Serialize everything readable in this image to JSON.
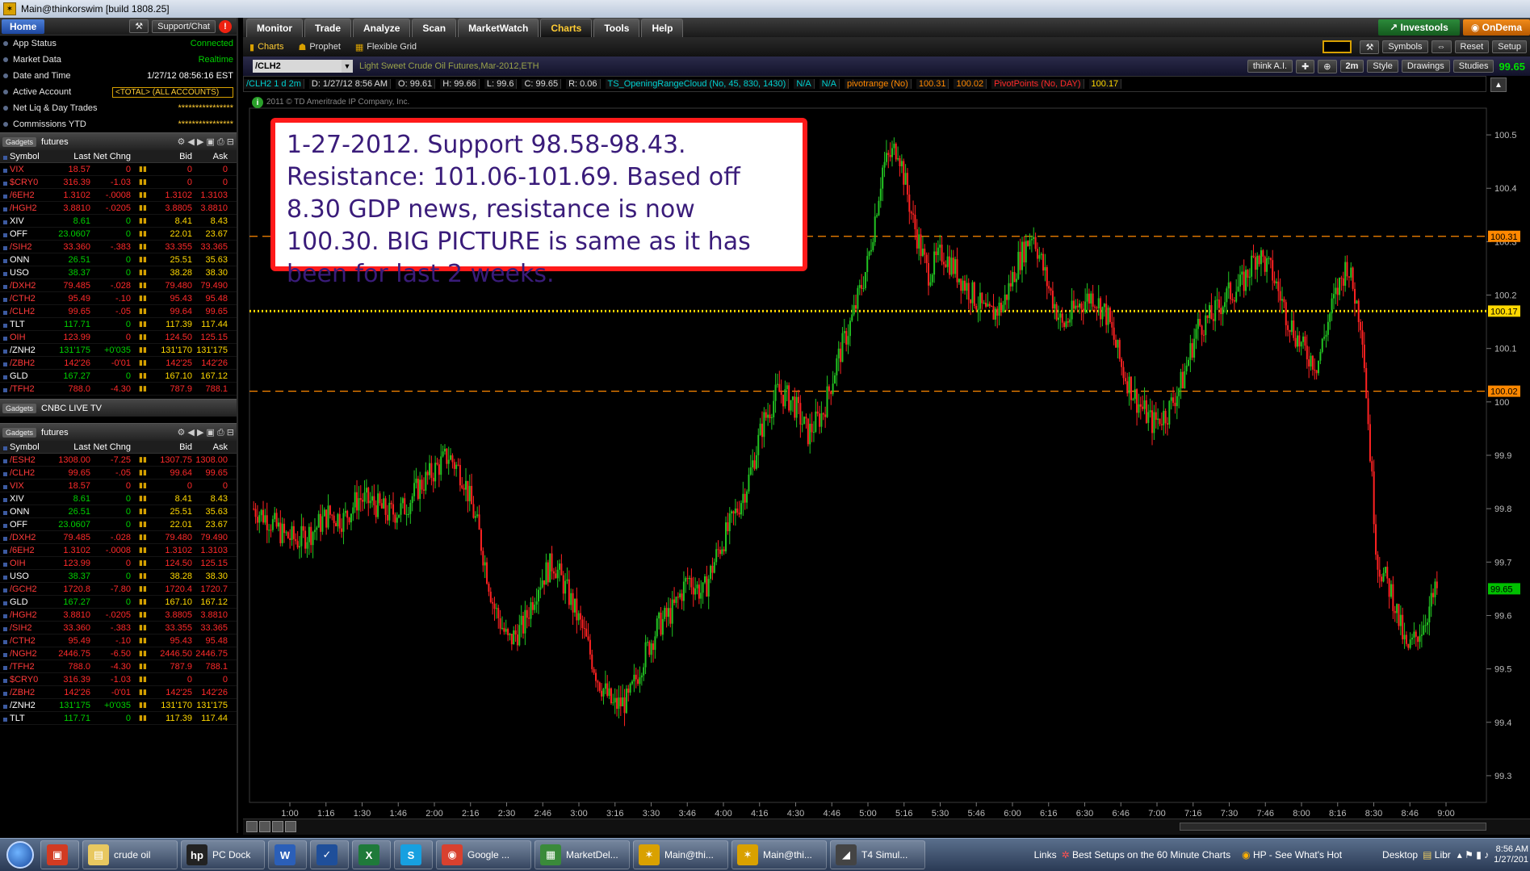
{
  "window": {
    "title": "Main@thinkorswim [build 1808.25]"
  },
  "left": {
    "home_label": "Home",
    "support_label": "Support/Chat",
    "status": [
      {
        "label": "App Status",
        "value": "Connected"
      },
      {
        "label": "Market Data",
        "value": "Realtime"
      },
      {
        "label": "Date and Time",
        "value": "1/27/12 08:56:16 EST"
      },
      {
        "label": "Active Account",
        "value": "<TOTAL> (ALL ACCOUNTS)"
      },
      {
        "label": "Net Liq & Day Trades",
        "value": "****************"
      },
      {
        "label": "Commissions YTD",
        "value": "****************"
      }
    ],
    "gadgets_label": "Gadgets",
    "wl1_name": "futures",
    "cnbc_label": "CNBC LIVE TV",
    "wl2_name": "futures",
    "columns": {
      "symbol": "Symbol",
      "last": "Last",
      "chg": "Net Chng",
      "bid": "Bid",
      "ask": "Ask"
    },
    "watchlist1": [
      [
        "VIX",
        "18.57",
        "0",
        "0",
        "0",
        "dn"
      ],
      [
        "$CRY0",
        "316.39",
        "-1.03",
        "0",
        "0",
        "dn"
      ],
      [
        "/6EH2",
        "1.3102",
        "-.0008",
        "1.3102",
        "1.3103",
        "dn"
      ],
      [
        "/HGH2",
        "3.8810",
        "-.0205",
        "3.8805",
        "3.8810",
        "dn"
      ],
      [
        "XIV",
        "8.61",
        "0",
        "8.41",
        "8.43",
        "up"
      ],
      [
        "OFF",
        "23.0607",
        "0",
        "22.01",
        "23.67",
        "up"
      ],
      [
        "/SIH2",
        "33.360",
        "-.383",
        "33.355",
        "33.365",
        "dn"
      ],
      [
        "ONN",
        "26.51",
        "0",
        "25.51",
        "35.63",
        "up"
      ],
      [
        "USO",
        "38.37",
        "0",
        "38.28",
        "38.30",
        "up"
      ],
      [
        "/DXH2",
        "79.485",
        "-.028",
        "79.480",
        "79.490",
        "dn"
      ],
      [
        "/CTH2",
        "95.49",
        "-.10",
        "95.43",
        "95.48",
        "dn"
      ],
      [
        "/CLH2",
        "99.65",
        "-.05",
        "99.64",
        "99.65",
        "dn"
      ],
      [
        "TLT",
        "117.71",
        "0",
        "117.39",
        "117.44",
        "up"
      ],
      [
        "OIH",
        "123.99",
        "0",
        "124.50",
        "125.15",
        "dn"
      ],
      [
        "/ZNH2",
        "131'175",
        "+0'035",
        "131'170",
        "131'175",
        "up"
      ],
      [
        "/ZBH2",
        "142'26",
        "-0'01",
        "142'25",
        "142'26",
        "dn"
      ],
      [
        "GLD",
        "167.27",
        "0",
        "167.10",
        "167.12",
        "up"
      ],
      [
        "/TFH2",
        "788.0",
        "-4.30",
        "787.9",
        "788.1",
        "dn"
      ]
    ],
    "watchlist2": [
      [
        "/ESH2",
        "1308.00",
        "-7.25",
        "1307.75",
        "1308.00",
        "dn"
      ],
      [
        "/CLH2",
        "99.65",
        "-.05",
        "99.64",
        "99.65",
        "dn"
      ],
      [
        "VIX",
        "18.57",
        "0",
        "0",
        "0",
        "dn"
      ],
      [
        "XIV",
        "8.61",
        "0",
        "8.41",
        "8.43",
        "up"
      ],
      [
        "ONN",
        "26.51",
        "0",
        "25.51",
        "35.63",
        "up"
      ],
      [
        "OFF",
        "23.0607",
        "0",
        "22.01",
        "23.67",
        "up"
      ],
      [
        "/DXH2",
        "79.485",
        "-.028",
        "79.480",
        "79.490",
        "dn"
      ],
      [
        "/6EH2",
        "1.3102",
        "-.0008",
        "1.3102",
        "1.3103",
        "dn"
      ],
      [
        "OIH",
        "123.99",
        "0",
        "124.50",
        "125.15",
        "dn"
      ],
      [
        "USO",
        "38.37",
        "0",
        "38.28",
        "38.30",
        "up"
      ],
      [
        "/GCH2",
        "1720.8",
        "-7.80",
        "1720.4",
        "1720.7",
        "dn"
      ],
      [
        "GLD",
        "167.27",
        "0",
        "167.10",
        "167.12",
        "up"
      ],
      [
        "/HGH2",
        "3.8810",
        "-.0205",
        "3.8805",
        "3.8810",
        "dn"
      ],
      [
        "/SIH2",
        "33.360",
        "-.383",
        "33.355",
        "33.365",
        "dn"
      ],
      [
        "/CTH2",
        "95.49",
        "-.10",
        "95.43",
        "95.48",
        "dn"
      ],
      [
        "/NGH2",
        "2446.75",
        "-6.50",
        "2446.50",
        "2446.75",
        "dn"
      ],
      [
        "/TFH2",
        "788.0",
        "-4.30",
        "787.9",
        "788.1",
        "dn"
      ],
      [
        "$CRY0",
        "316.39",
        "-1.03",
        "0",
        "0",
        "dn"
      ],
      [
        "/ZBH2",
        "142'26",
        "-0'01",
        "142'25",
        "142'26",
        "dn"
      ],
      [
        "/ZNH2",
        "131'175",
        "+0'035",
        "131'170",
        "131'175",
        "up"
      ],
      [
        "TLT",
        "117.71",
        "0",
        "117.39",
        "117.44",
        "up"
      ]
    ]
  },
  "tabs": [
    "Monitor",
    "Trade",
    "Analyze",
    "Scan",
    "MarketWatch",
    "Charts",
    "Tools",
    "Help"
  ],
  "active_tab": "Charts",
  "investools_label": "Investools",
  "ondemand_label": "OnDema",
  "subtabs": [
    "Charts",
    "Prophet",
    "Flexible Grid"
  ],
  "toolbar": {
    "symbols": "Symbols",
    "reset": "Reset",
    "setup": "Setup",
    "think": "think A.I.",
    "period": "2m",
    "style": "Style",
    "drawings": "Drawings",
    "studies": "Studies",
    "last_price": "99.65"
  },
  "chart_header": {
    "symbol": "/CLH2",
    "description": "Light Sweet Crude Oil Futures,Mar-2012,ETH",
    "study_items": [
      {
        "t": "/CLH2 1 d 2m",
        "c": "#00d0d0"
      },
      {
        "t": "D: 1/27/12 8:56 AM",
        "c": "#dddddd"
      },
      {
        "t": "O: 99.61",
        "c": "#dddddd"
      },
      {
        "t": "H: 99.66",
        "c": "#dddddd"
      },
      {
        "t": "L: 99.6",
        "c": "#dddddd"
      },
      {
        "t": "C: 99.65",
        "c": "#dddddd"
      },
      {
        "t": "R: 0.06",
        "c": "#dddddd"
      },
      {
        "t": "TS_OpeningRangeCloud (No, 45, 830, 1430)",
        "c": "#00d0d0"
      },
      {
        "t": "N/A",
        "c": "#00d0d0"
      },
      {
        "t": "N/A",
        "c": "#00d0d0"
      },
      {
        "t": "pivotrange (No)",
        "c": "#ff8800"
      },
      {
        "t": "100.31",
        "c": "#ff8800"
      },
      {
        "t": "100.02",
        "c": "#ff8800"
      },
      {
        "t": "PivotPoints (No, DAY)",
        "c": "#ff2a2a"
      },
      {
        "t": "100.17",
        "c": "#ffd800"
      }
    ],
    "copyright": "2011 © TD Ameritrade IP Company, Inc."
  },
  "annotation": "1-27-2012. Support 98.58-98.43. Resistance: 101.06-101.69. Based off 8.30 GDP news, resistance is now 100.30. BIG PICTURE is same as it has been for last 2 weeks.",
  "chart_data": {
    "type": "candlestick",
    "x_ticks": [
      "1:00",
      "1:16",
      "1:30",
      "1:46",
      "2:00",
      "2:16",
      "2:30",
      "2:46",
      "3:00",
      "3:16",
      "3:30",
      "3:46",
      "4:00",
      "4:16",
      "4:30",
      "4:46",
      "5:00",
      "5:16",
      "5:30",
      "5:46",
      "6:00",
      "6:16",
      "6:30",
      "6:46",
      "7:00",
      "7:16",
      "7:30",
      "7:46",
      "8:00",
      "8:16",
      "8:30",
      "8:46",
      "9:00"
    ],
    "y_ticks": [
      "100.5",
      "100.4",
      "100.3",
      "100.2",
      "100.1",
      "100",
      "99.9",
      "99.8",
      "99.7",
      "99.6",
      "99.5",
      "99.4",
      "99.3"
    ],
    "ylim": [
      99.25,
      100.55
    ],
    "levels": [
      {
        "value": 100.31,
        "label": "100.31",
        "style": "dashed",
        "color": "#ff8800"
      },
      {
        "value": 100.17,
        "label": "100.17",
        "style": "dotted",
        "color": "#ffd800"
      },
      {
        "value": 100.02,
        "label": "100.02",
        "style": "dashed",
        "color": "#ff8800"
      }
    ],
    "last_price": {
      "value": 99.65,
      "label": "99.65",
      "color": "#00c000"
    },
    "closes": [
      99.8,
      99.78,
      99.75,
      99.74,
      99.76,
      99.79,
      99.78,
      99.82,
      99.81,
      99.79,
      99.8,
      99.84,
      99.87,
      99.9,
      99.86,
      99.76,
      99.62,
      99.55,
      99.58,
      99.66,
      99.7,
      99.64,
      99.57,
      99.48,
      99.43,
      99.44,
      99.52,
      99.58,
      99.61,
      99.67,
      99.64,
      99.72,
      99.78,
      99.85,
      99.96,
      100.02,
      100.0,
      99.94,
      99.98,
      100.08,
      100.16,
      100.26,
      100.44,
      100.48,
      100.34,
      100.24,
      100.28,
      100.24,
      100.2,
      100.16,
      100.18,
      100.26,
      100.32,
      100.22,
      100.14,
      100.18,
      100.2,
      100.16,
      100.06,
      100.0,
      99.96,
      99.98,
      100.04,
      100.14,
      100.16,
      100.2,
      100.22,
      100.28,
      100.24,
      100.16,
      100.1,
      100.07,
      100.18,
      100.26,
      100.14,
      99.7,
      99.64,
      99.53,
      99.58,
      99.65
    ]
  },
  "taskbar": {
    "items": [
      {
        "label": "",
        "color": "#d23b22",
        "glyph": "▣"
      },
      {
        "label": "crude oil",
        "color": "#e8c860",
        "glyph": "▤"
      },
      {
        "label": "PC Dock",
        "color": "#222",
        "glyph": "hp"
      },
      {
        "label": "",
        "color": "#2b5fb8",
        "glyph": "W"
      },
      {
        "label": "",
        "color": "#1f4f9a",
        "glyph": "✓"
      },
      {
        "label": "",
        "color": "#1f7a3a",
        "glyph": "X"
      },
      {
        "label": "",
        "color": "#17a0e0",
        "glyph": "S"
      },
      {
        "label": "Google ...",
        "color": "#d8412f",
        "glyph": "◉"
      },
      {
        "label": "MarketDel...",
        "color": "#3a8a3a",
        "glyph": "▦"
      },
      {
        "label": "Main@thi...",
        "color": "#d9a100",
        "glyph": "✶"
      },
      {
        "label": "Main@thi...",
        "color": "#d9a100",
        "glyph": "✶"
      },
      {
        "label": "T4 Simul...",
        "color": "#444",
        "glyph": "◢"
      }
    ],
    "links_label": "Links",
    "link1": "Best Setups on the 60 Minute Charts",
    "link2": "HP - See What's Hot",
    "desktop": "Desktop",
    "libr": "Libr",
    "time": "8:56 AM",
    "date": "1/27/201"
  }
}
